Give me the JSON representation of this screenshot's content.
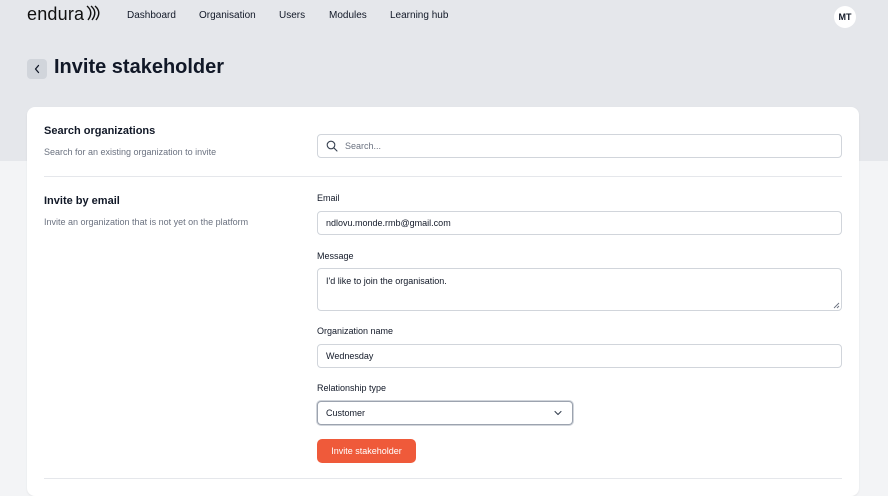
{
  "app": {
    "logo_text": "endura",
    "nav": [
      "Dashboard",
      "Organisation",
      "Users",
      "Modules",
      "Learning hub"
    ],
    "avatar_initials": "MT"
  },
  "page": {
    "title": "Invite stakeholder"
  },
  "search_section": {
    "title": "Search organizations",
    "description": "Search for an existing organization to invite",
    "placeholder": "Search..."
  },
  "email_section": {
    "title": "Invite by email",
    "description": "Invite an organization that is not yet on the platform",
    "email_label": "Email",
    "email_value": "ndlovu.monde.rmb@gmail.com",
    "message_label": "Message",
    "message_value": "I'd like to join the organisation.",
    "org_name_label": "Organization name",
    "org_name_value": "Wednesday",
    "relationship_label": "Relationship type",
    "relationship_value": "Customer",
    "submit_label": "Invite stakeholder"
  },
  "colors": {
    "accent": "#ef5a3a",
    "header_band": "#e5e7eb",
    "page_bg": "#f3f4f6"
  },
  "icons": [
    "logo-wave-icon",
    "chevron-left-icon",
    "search-icon",
    "resize-handle-icon",
    "chevron-down-icon"
  ]
}
